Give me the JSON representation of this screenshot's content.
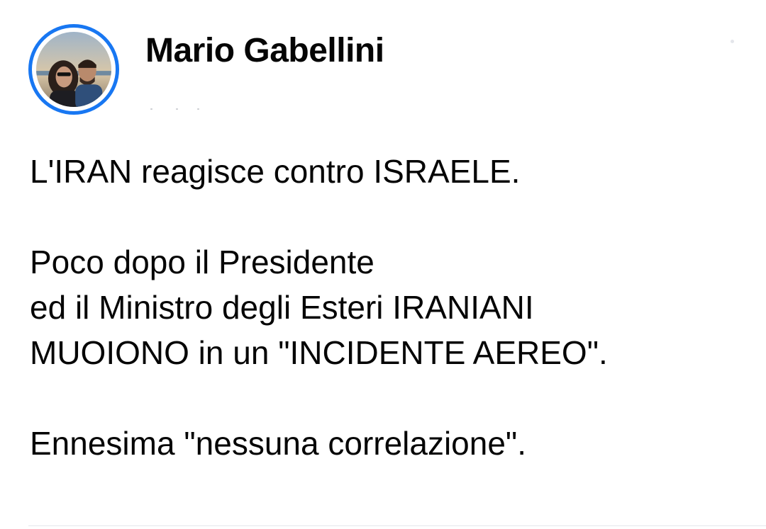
{
  "author": {
    "name": "Mario Gabellini",
    "avatar_icon": "profile-photo-couple",
    "avatar_ring_color": "#1877f2"
  },
  "post": {
    "paragraphs": [
      {
        "lines": [
          "L'IRAN reagisce contro ISRAELE."
        ]
      },
      {
        "lines": [
          "Poco dopo il Presidente",
          "ed il Ministro degli Esteri IRANIANI",
          "MUOIONO in un \"INCIDENTE AEREO\"."
        ]
      },
      {
        "lines": [
          "Ennesima \"nessuna correlazione\"."
        ]
      }
    ]
  }
}
